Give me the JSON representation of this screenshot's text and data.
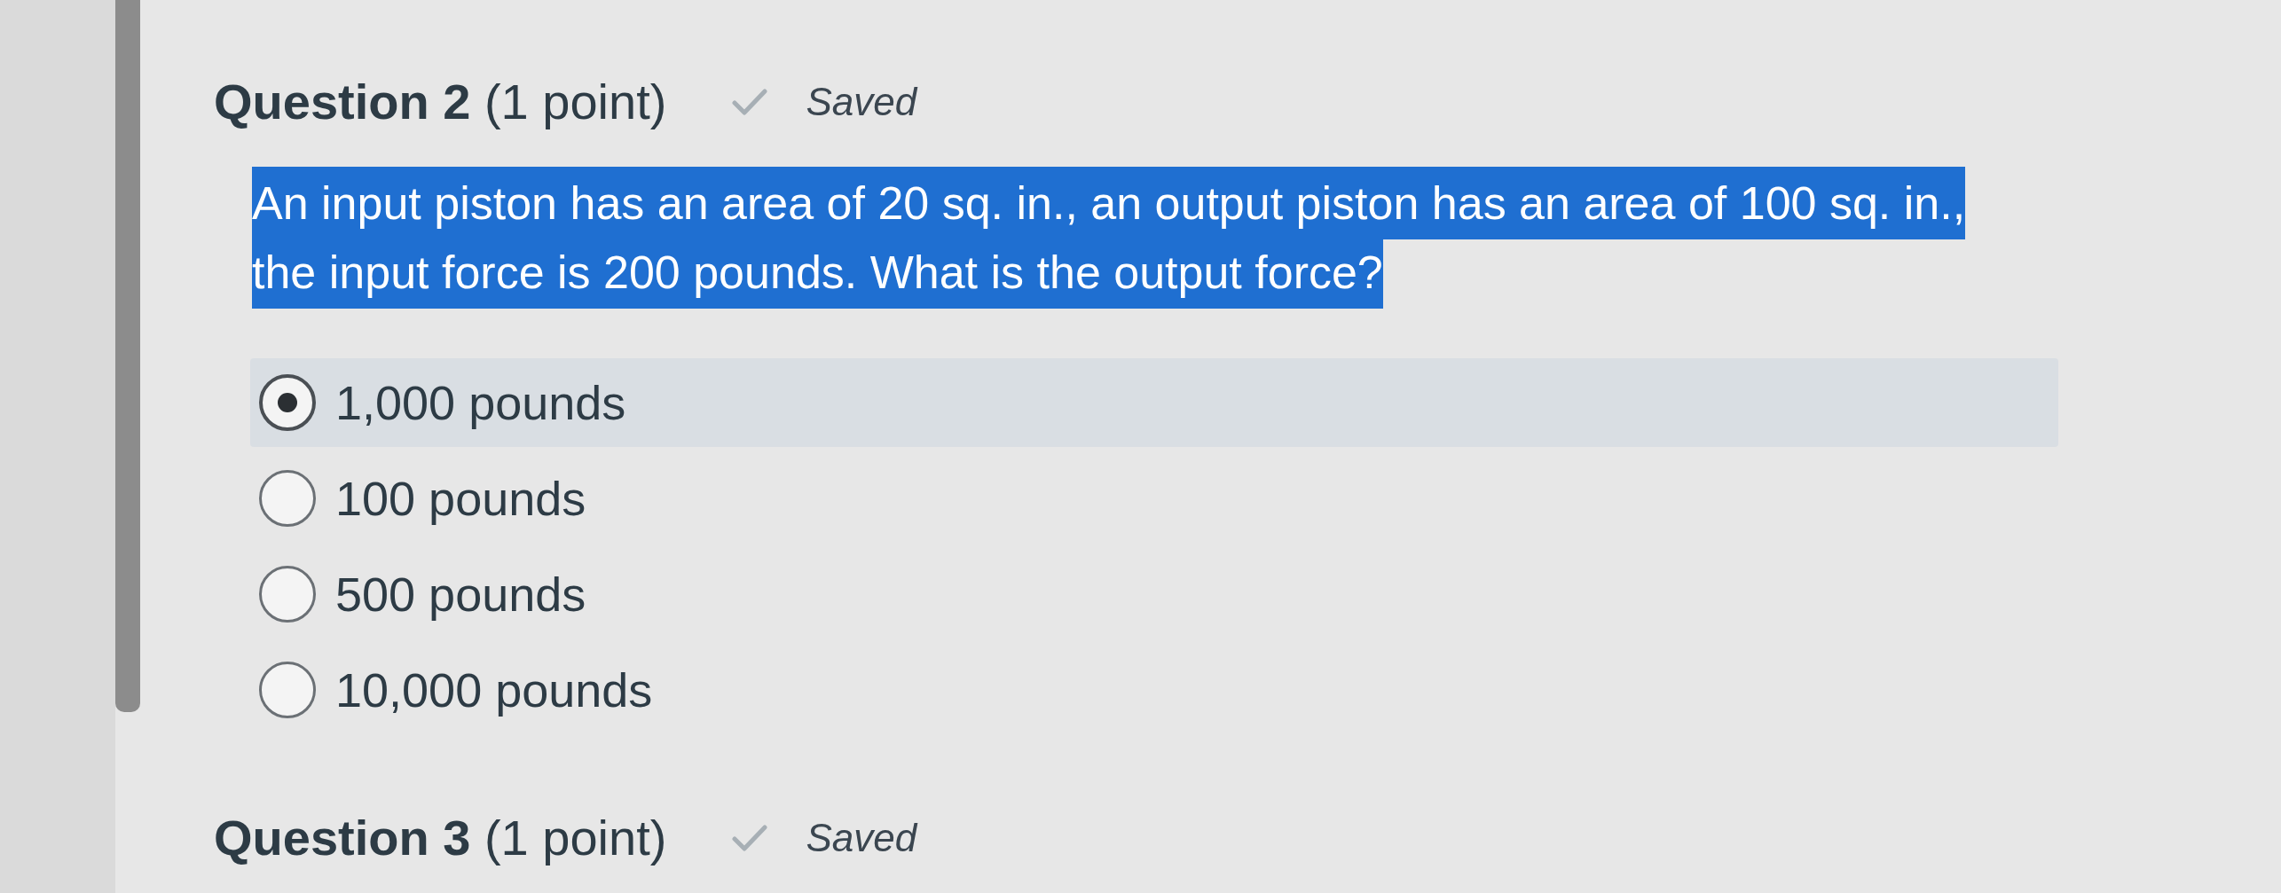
{
  "questions": [
    {
      "title": "**Question 2** (1 point)",
      "status": "Saved",
      "text": "An input piston has an area of 20 sq. in., an output piston has an area of 100 sq. in., the input force is 200 pounds. What is the output force?",
      "highlighted": true,
      "options": [
        {
          "label": "1,000 pounds",
          "selected": true
        },
        {
          "label": "100 pounds",
          "selected": false
        },
        {
          "label": "500 pounds",
          "selected": false
        },
        {
          "label": "10,000 pounds",
          "selected": false
        }
      ]
    },
    {
      "title": "**Question 3** (1 point)",
      "status": "Saved"
    }
  ]
}
